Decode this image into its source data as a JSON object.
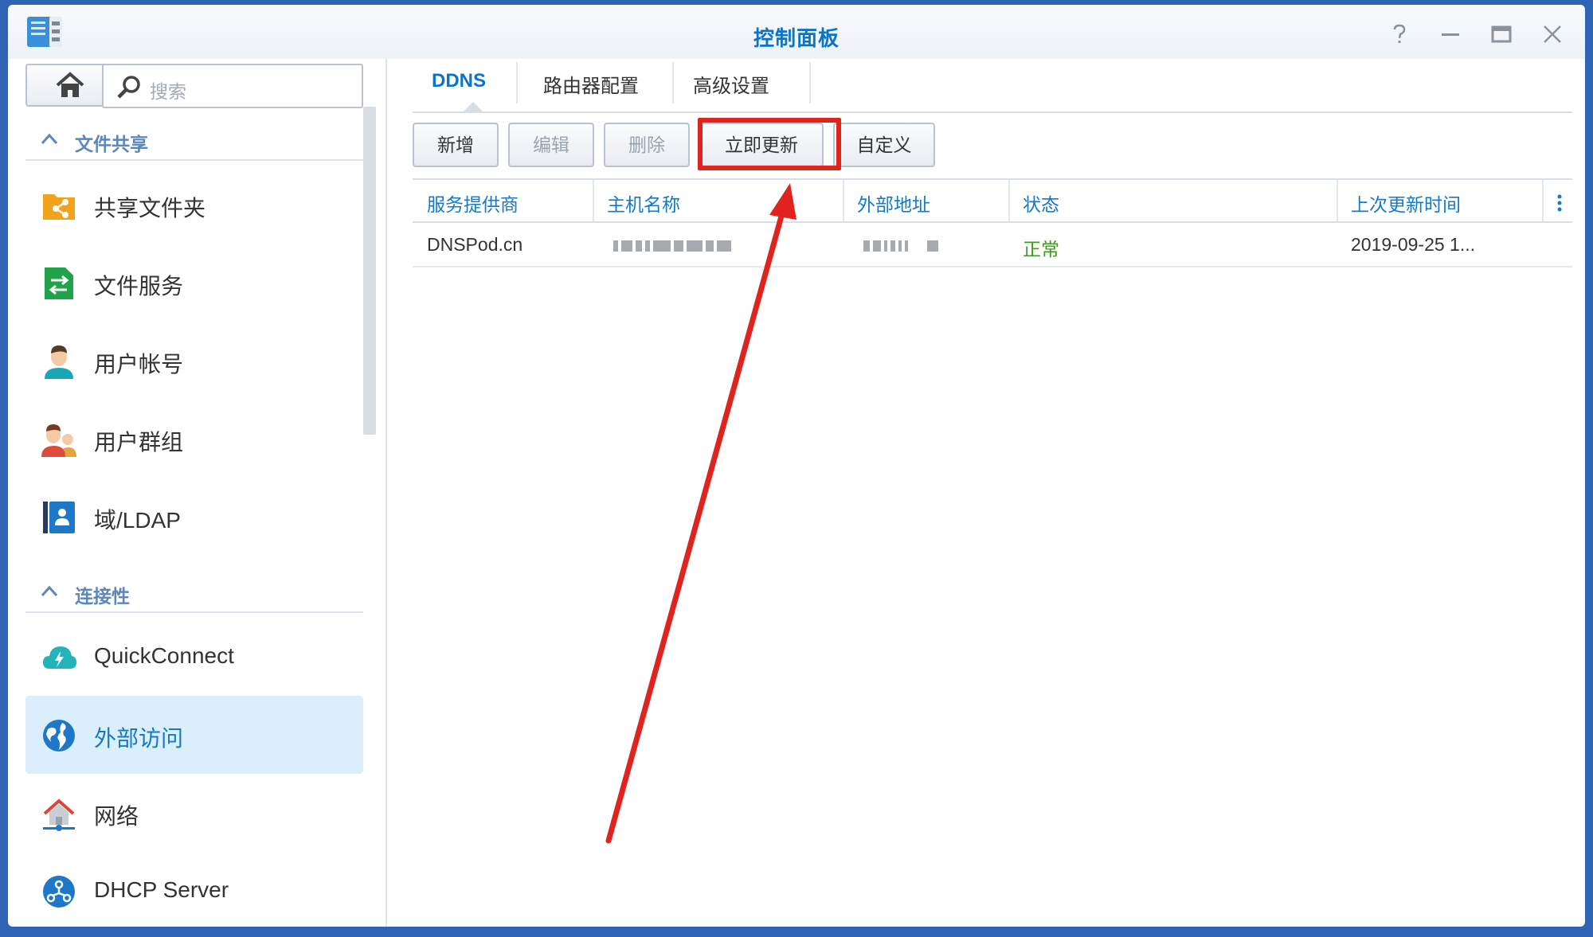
{
  "window": {
    "title": "控制面板"
  },
  "sidebar": {
    "search_placeholder": "搜索",
    "sections": [
      {
        "label": "文件共享",
        "items": [
          {
            "label": "共享文件夹",
            "icon": "shared-folder-icon"
          },
          {
            "label": "文件服务",
            "icon": "file-services-icon"
          },
          {
            "label": "用户帐号",
            "icon": "user-icon"
          },
          {
            "label": "用户群组",
            "icon": "group-icon"
          },
          {
            "label": "域/LDAP",
            "icon": "ldap-icon"
          }
        ]
      },
      {
        "label": "连接性",
        "items": [
          {
            "label": "QuickConnect",
            "icon": "quickconnect-icon"
          },
          {
            "label": "外部访问",
            "icon": "external-access-icon",
            "active": true
          },
          {
            "label": "网络",
            "icon": "network-icon"
          },
          {
            "label": "DHCP Server",
            "icon": "dhcp-icon"
          }
        ]
      }
    ]
  },
  "tabs": [
    "DDNS",
    "路由器配置",
    "高级设置"
  ],
  "active_tab": "DDNS",
  "toolbar": {
    "add": "新增",
    "edit": "编辑",
    "delete": "删除",
    "update_now": "立即更新",
    "customize": "自定义"
  },
  "table": {
    "columns": [
      "服务提供商",
      "主机名称",
      "外部地址",
      "状态",
      "上次更新时间"
    ],
    "rows": [
      {
        "provider": "DNSPod.cn",
        "status": "正常",
        "last_update": "2019-09-25 1..."
      }
    ]
  },
  "colors": {
    "accent": "#1579c7",
    "status_ok": "#3c9a1e",
    "annotation": "#e0231c",
    "desktop": "#2f63b4"
  }
}
